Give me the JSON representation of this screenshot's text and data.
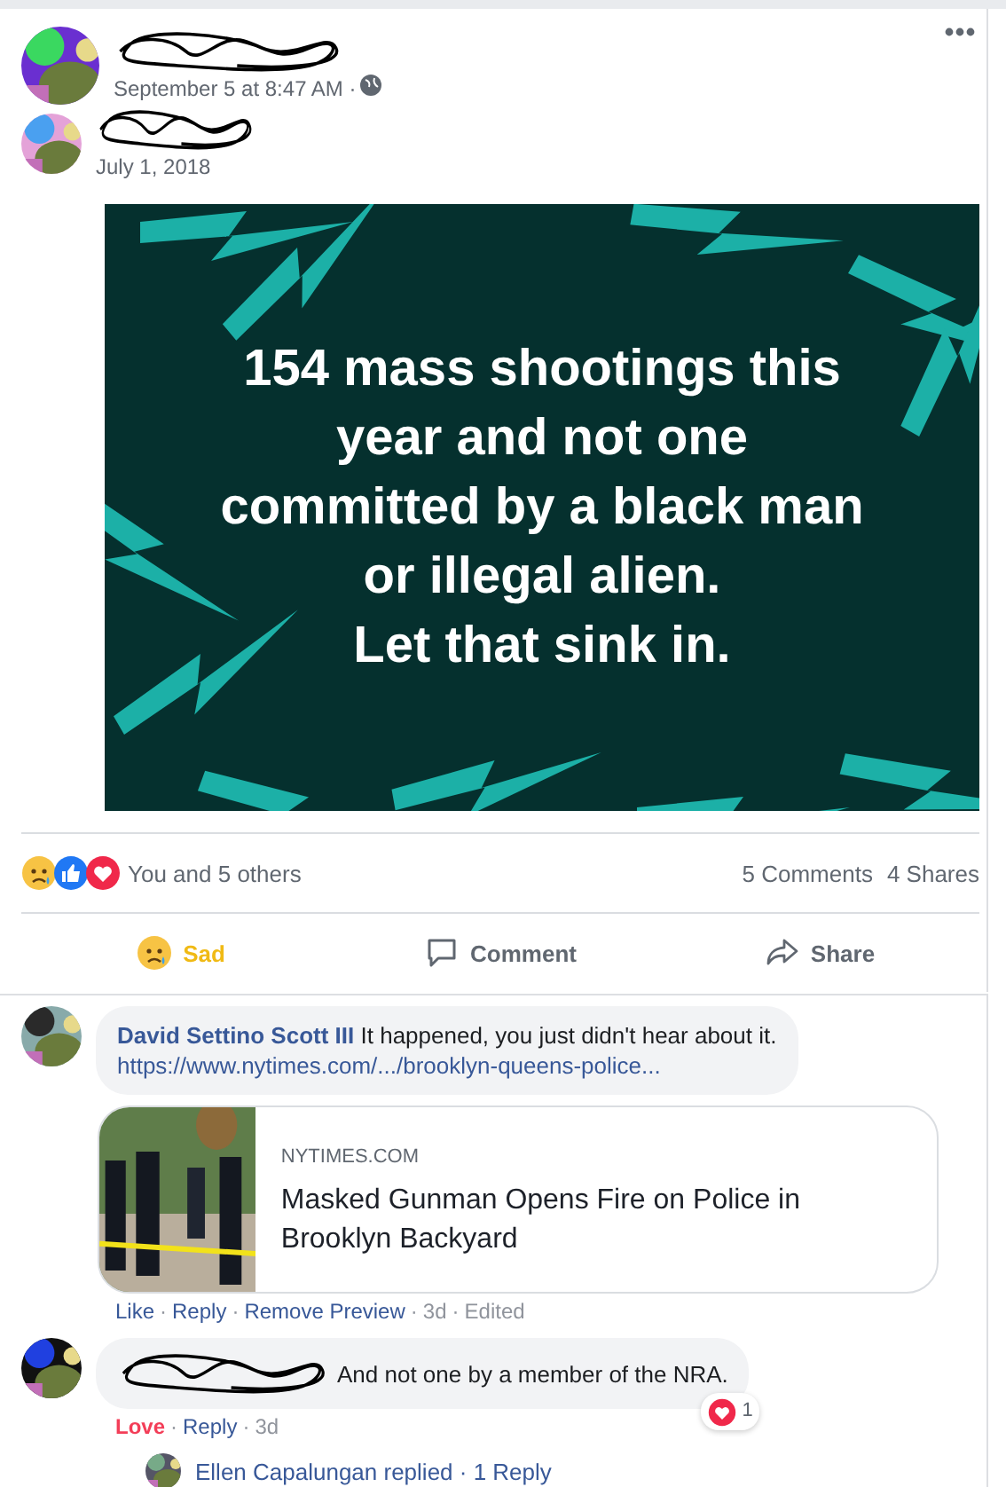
{
  "post": {
    "time": "September 5 at 8:47 AM ·",
    "shared_date": "July 1, 2018",
    "image_lines": [
      "154 mass shootings this",
      "year and not one",
      "committed by a black man",
      "or illegal alien.",
      "Let that sink in."
    ]
  },
  "reactions": [
    {
      "kind": "sad"
    },
    {
      "kind": "like"
    },
    {
      "kind": "love"
    }
  ],
  "reaction_summary": "You and 5 others",
  "comment_count": "5 Comments",
  "share_count": "4 Shares",
  "actions": [
    {
      "kind": "sad",
      "label": "Sad",
      "selected": true
    },
    {
      "kind": "comment",
      "label": "Comment",
      "selected": false
    },
    {
      "kind": "share",
      "label": "Share",
      "selected": false
    }
  ],
  "comments": [
    {
      "author": "David Settino Scott III",
      "text": "It happened, you just didn't hear about it.",
      "link": "https://www.nytimes.com/.../brooklyn-queens-police...",
      "preview": {
        "source": "NYTIMES.COM",
        "title": "Masked Gunman Opens Fire on Police in Brooklyn Backyard"
      },
      "meta": [
        {
          "label": "Like",
          "kind": "link",
          "selected": false
        },
        {
          "label": "Reply",
          "kind": "link",
          "selected": false
        },
        {
          "label": "Remove Preview",
          "kind": "link",
          "selected": false
        },
        {
          "label": "3d",
          "kind": "text",
          "selected": false
        },
        {
          "label": "Edited",
          "kind": "text",
          "selected": false
        }
      ]
    },
    {
      "text": "And not one by a member of the NRA.",
      "reaction_count": "1",
      "meta": [
        {
          "label": "Love",
          "kind": "link",
          "selected": true
        },
        {
          "label": "Reply",
          "kind": "link",
          "selected": false
        },
        {
          "label": "3d",
          "kind": "text",
          "selected": false
        }
      ]
    }
  ],
  "meta_separator": "·",
  "reply_line": "Ellen Capalungan replied · 1 Reply"
}
